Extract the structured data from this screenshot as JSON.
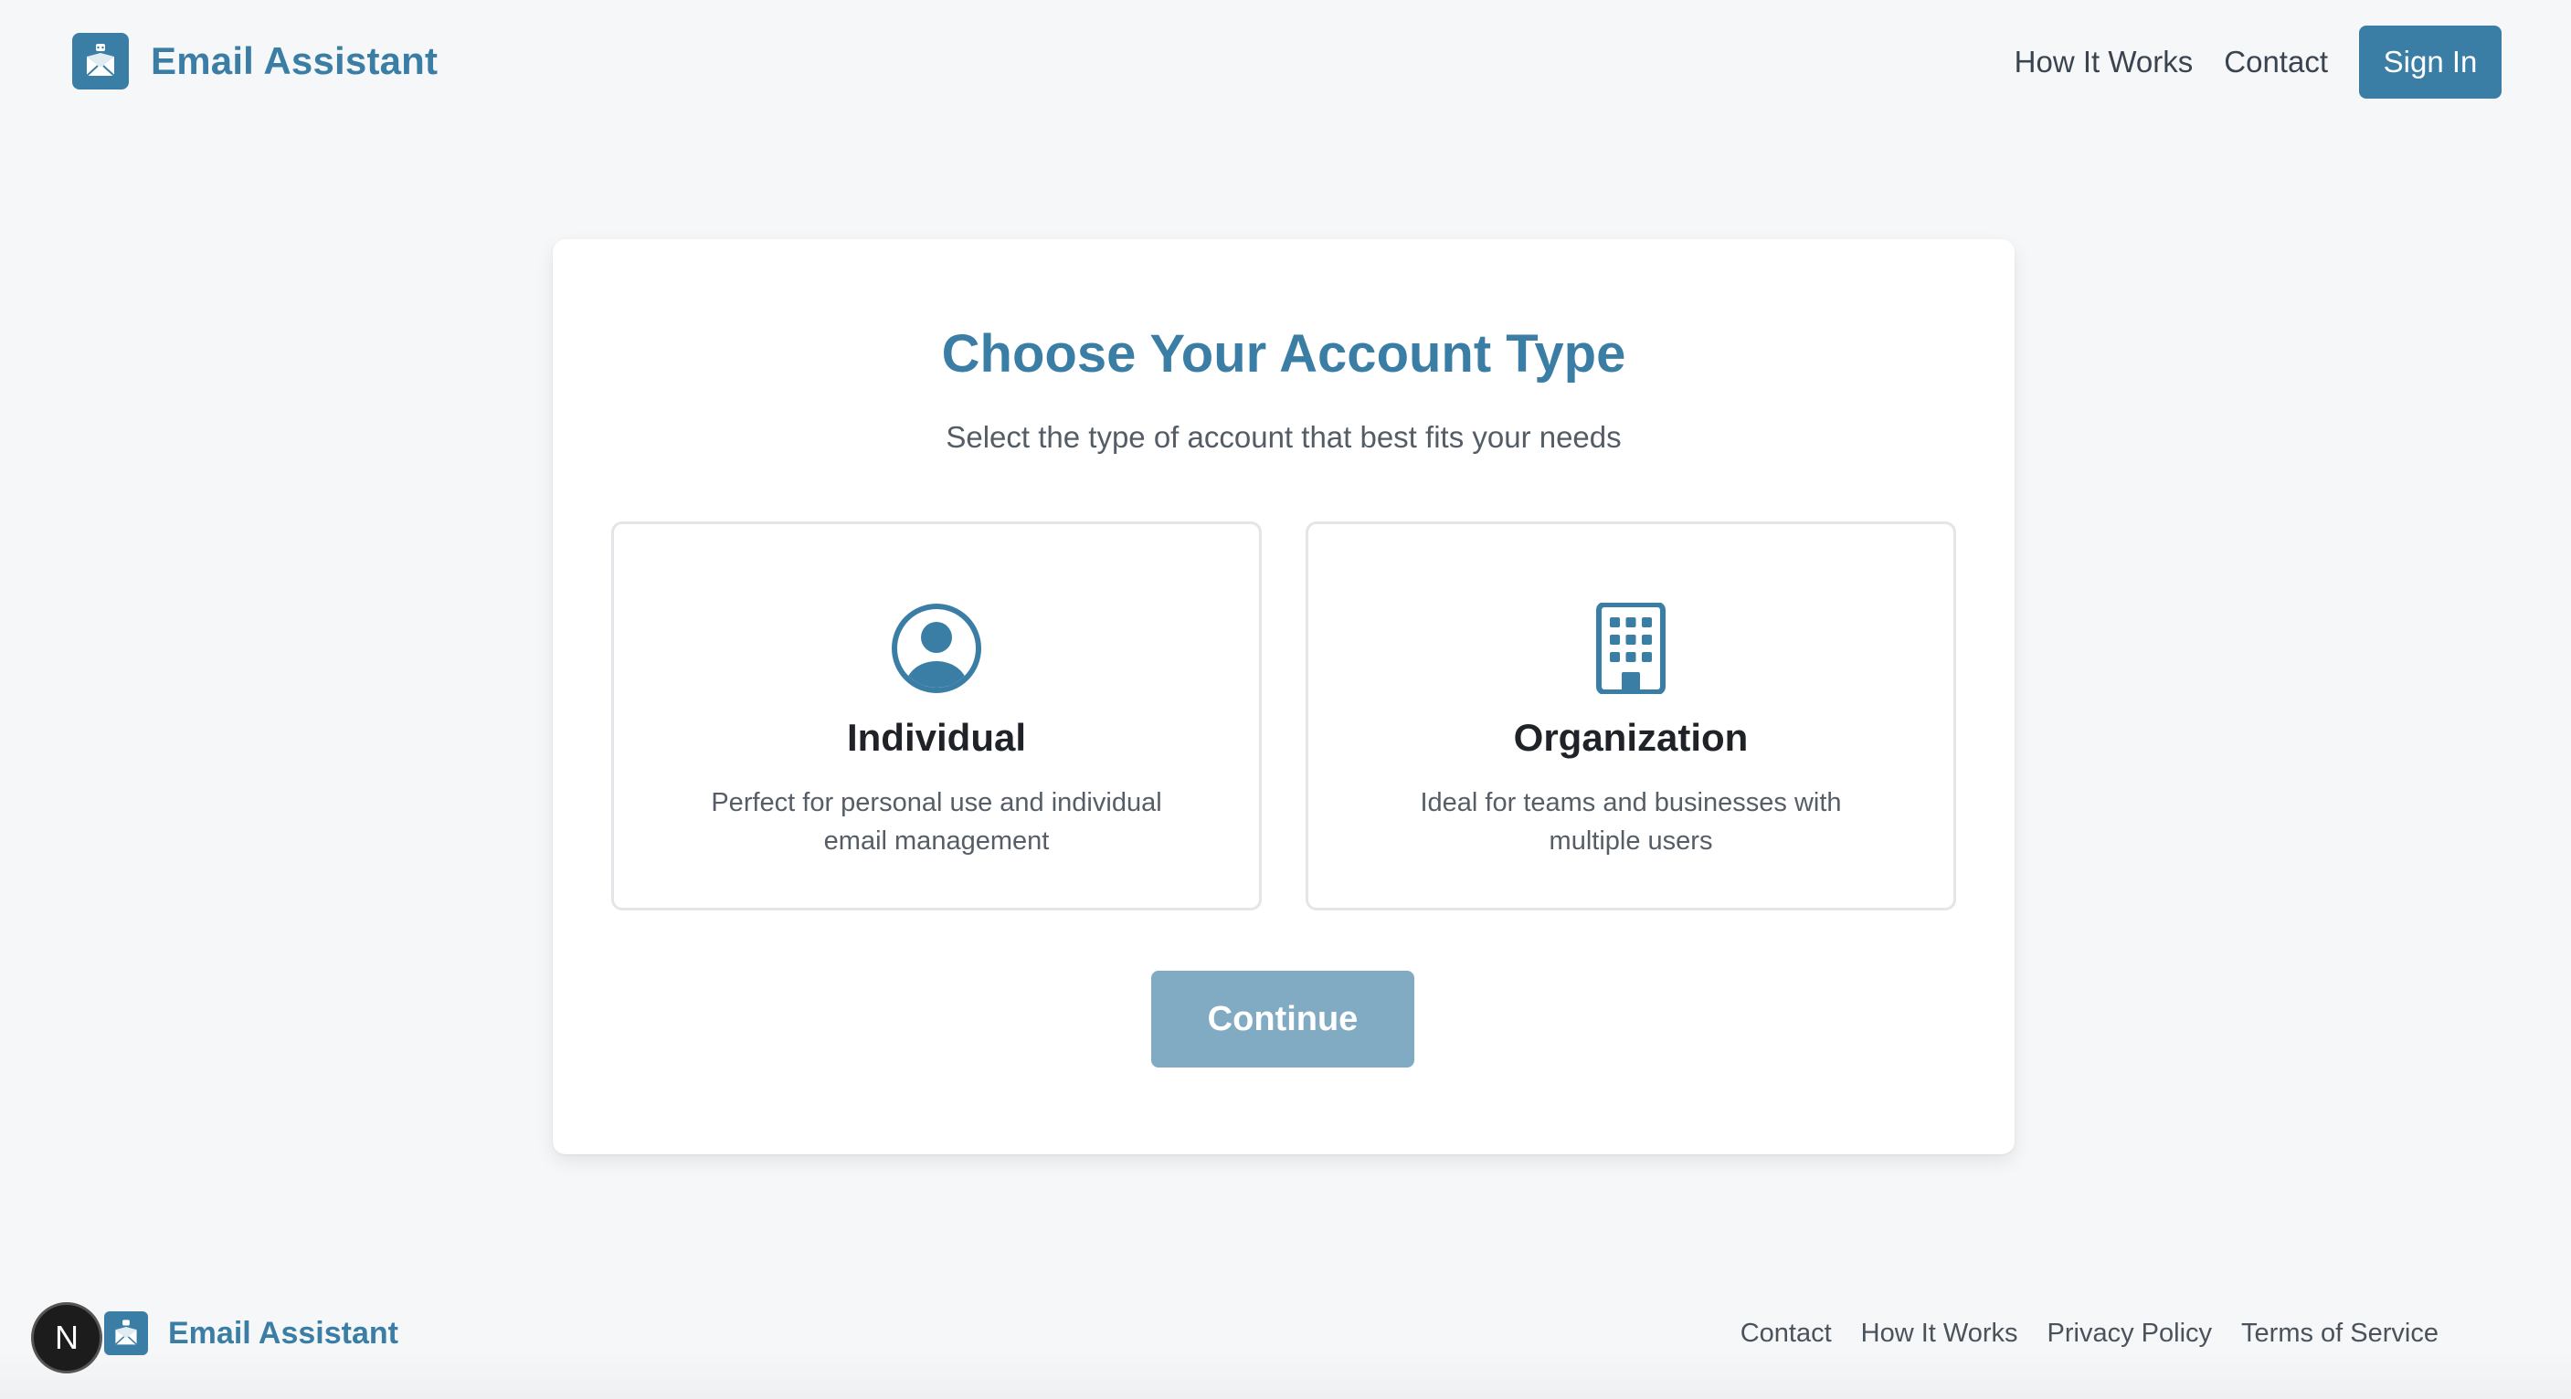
{
  "header": {
    "brand_name": "Email Assistant",
    "nav": [
      "How It Works",
      "Contact"
    ],
    "signin_label": "Sign In"
  },
  "card": {
    "title": "Choose Your Account Type",
    "subtitle": "Select the type of account that best fits your needs",
    "options": [
      {
        "title": "Individual",
        "description": "Perfect for personal use and individual email management",
        "icon": "user-circle-icon"
      },
      {
        "title": "Organization",
        "description": "Ideal for teams and businesses with multiple users",
        "icon": "building-icon"
      }
    ],
    "continue_label": "Continue"
  },
  "footer": {
    "badge_letter": "N",
    "brand_name": "Email Assistant",
    "links": [
      "Contact",
      "How It Works",
      "Privacy Policy",
      "Terms of Service"
    ]
  },
  "colors": {
    "accent": "#3b7ea5",
    "continue_disabled": "#80abc3",
    "background": "#f6f7f8"
  }
}
